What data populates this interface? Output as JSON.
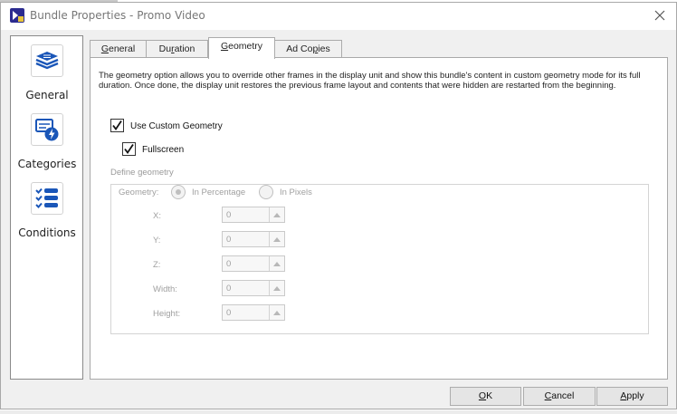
{
  "window": {
    "title": "Bundle Properties - Promo Video",
    "close_icon": "close-icon"
  },
  "sidebar": {
    "items": [
      {
        "label": "General",
        "icon": "stack-layers-icon"
      },
      {
        "label": "Categories",
        "icon": "category-lightning-icon"
      },
      {
        "label": "Conditions",
        "icon": "checklist-icon"
      }
    ]
  },
  "tabs": [
    {
      "label": "General",
      "accel": "G",
      "active": false
    },
    {
      "label": "Duration",
      "accel": "r",
      "active": false
    },
    {
      "label": "Geometry",
      "accel": "G",
      "active": true
    },
    {
      "label": "Ad Copies",
      "accel": "p",
      "active": false
    }
  ],
  "geometry": {
    "description": "The geometry option allows you to override other frames in the display unit and show this bundle's content in custom geometry mode for its full duration. Once done, the display unit restores the previous frame layout and contents that were hidden are restarted from the beginning.",
    "use_custom_label": "Use Custom Geometry",
    "use_custom_checked": true,
    "fullscreen_label": "Fullscreen",
    "fullscreen_checked": true,
    "define_label": "Define geometry",
    "geometry_label": "Geometry:",
    "mode_percentage": "In Percentage",
    "mode_pixels": "In Pixels",
    "selected_mode": "In Percentage",
    "fields": [
      {
        "label": "X:",
        "value": "0"
      },
      {
        "label": "Y:",
        "value": "0"
      },
      {
        "label": "Z:",
        "value": "0"
      },
      {
        "label": "Width:",
        "value": "0"
      },
      {
        "label": "Height:",
        "value": "0"
      }
    ]
  },
  "buttons": {
    "ok": "OK",
    "cancel": "Cancel",
    "apply": "Apply"
  },
  "colors": {
    "accent_blue": "#1a56b8",
    "disabled_gray": "#a0a0a0",
    "panel_bg": "#f0f0f0"
  }
}
